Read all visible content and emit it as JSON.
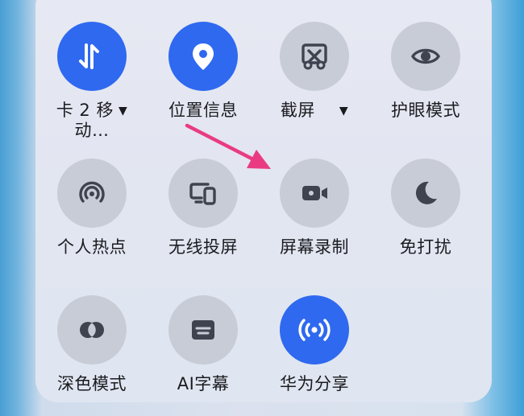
{
  "tiles": [
    {
      "label": "卡 2 移",
      "label2": "动…",
      "dropdown": "▼",
      "active": true,
      "icon": "mobile-data-icon"
    },
    {
      "label": "位置信息",
      "active": true,
      "icon": "location-pin-icon"
    },
    {
      "label": "截屏",
      "dropdown": "▼",
      "active": false,
      "icon": "screenshot-scissors-icon"
    },
    {
      "label": "护眼模式",
      "active": false,
      "icon": "eye-icon"
    },
    {
      "label": "个人热点",
      "active": false,
      "icon": "hotspot-icon"
    },
    {
      "label": "无线投屏",
      "active": false,
      "icon": "wireless-projection-icon"
    },
    {
      "label": "屏幕录制",
      "active": false,
      "icon": "screen-record-icon"
    },
    {
      "label": "免打扰",
      "active": false,
      "icon": "moon-icon"
    },
    {
      "label": "深色模式",
      "active": false,
      "icon": "dark-mode-icon"
    },
    {
      "label": "AI字幕",
      "active": false,
      "icon": "ai-subtitle-icon"
    },
    {
      "label": "华为分享",
      "active": true,
      "icon": "huawei-share-icon"
    }
  ],
  "colors": {
    "active": "#2f69f0",
    "inactive": "#c7ccd6",
    "icon_inactive": "#3f4350",
    "arrow": "#ea3b82"
  }
}
